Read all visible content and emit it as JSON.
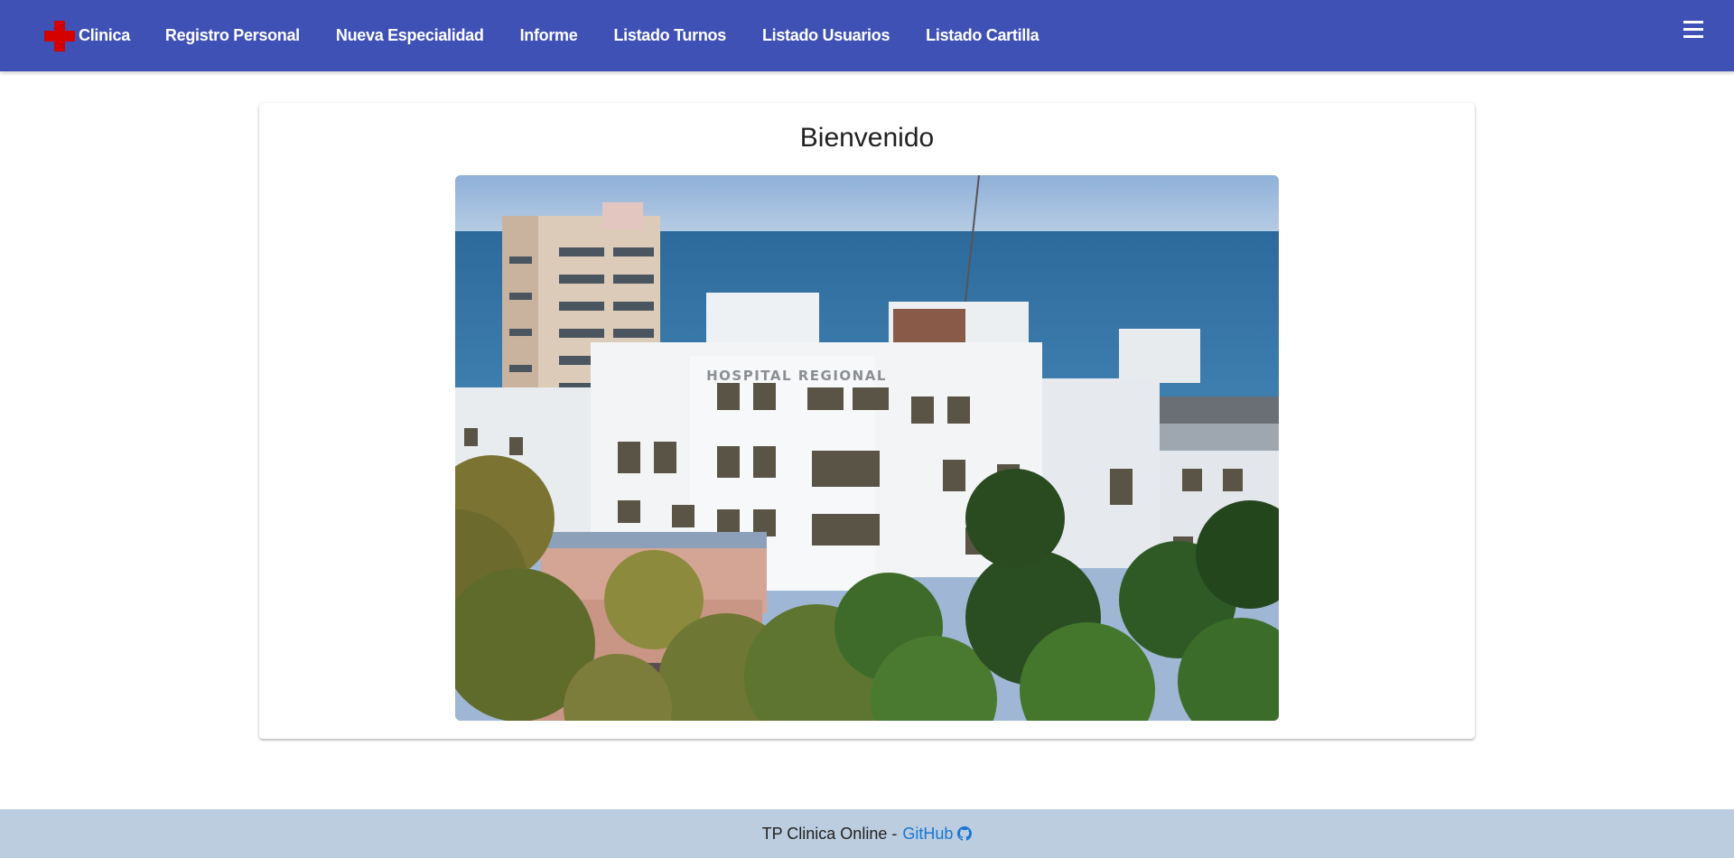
{
  "nav": {
    "brand": "Clinica",
    "items": [
      "Registro Personal",
      "Nueva Especialidad",
      "Informe",
      "Listado Turnos",
      "Listado Usuarios",
      "Listado Cartilla"
    ]
  },
  "main": {
    "title": "Bienvenido",
    "photo_sign": "HOSPITAL REGIONAL"
  },
  "footer": {
    "text": "TP Clinica Online -",
    "link_label": "GitHub"
  },
  "colors": {
    "navbar": "#3f51b5",
    "brand_cross": "#d50000",
    "footer_bg": "#bccddf",
    "link": "#1976d2"
  },
  "icons": {
    "brand": "red-cross-icon",
    "menu": "hamburger-menu-icon",
    "github": "github-icon"
  }
}
